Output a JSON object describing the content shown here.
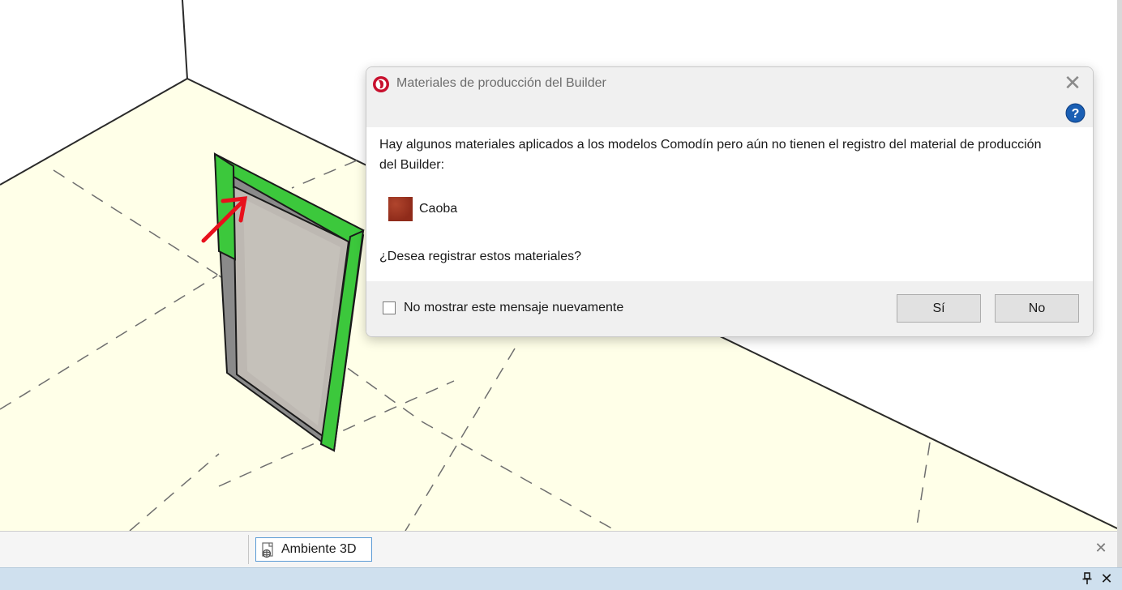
{
  "dialog": {
    "title": "Materiales de producción del Builder",
    "message": "Hay algunos materiales aplicados a los modelos Comodín pero aún no tienen el registro del material de producción del Builder:",
    "materials": [
      {
        "name": "Caoba",
        "color": "#9c3220"
      }
    ],
    "question": "¿Desea registrar estos materiales?",
    "checkbox_label": "No mostrar este mensaje nuevamente",
    "checkbox_checked": false,
    "yes_label": "Sí",
    "no_label": "No",
    "close_symbol": "✕",
    "help_symbol": "?"
  },
  "bottom_tabs": {
    "active_tab_label": "Ambiente 3D",
    "close_symbol": "✕"
  },
  "panel": {
    "pin_icon": "pin-icon",
    "close_symbol": "✕"
  },
  "colors": {
    "floor": "#ffffe8",
    "wall": "#ffffff",
    "frame_highlight": "#33cc33",
    "annotation_arrow": "#e8101c",
    "help_blue": "#1a5fb4"
  }
}
